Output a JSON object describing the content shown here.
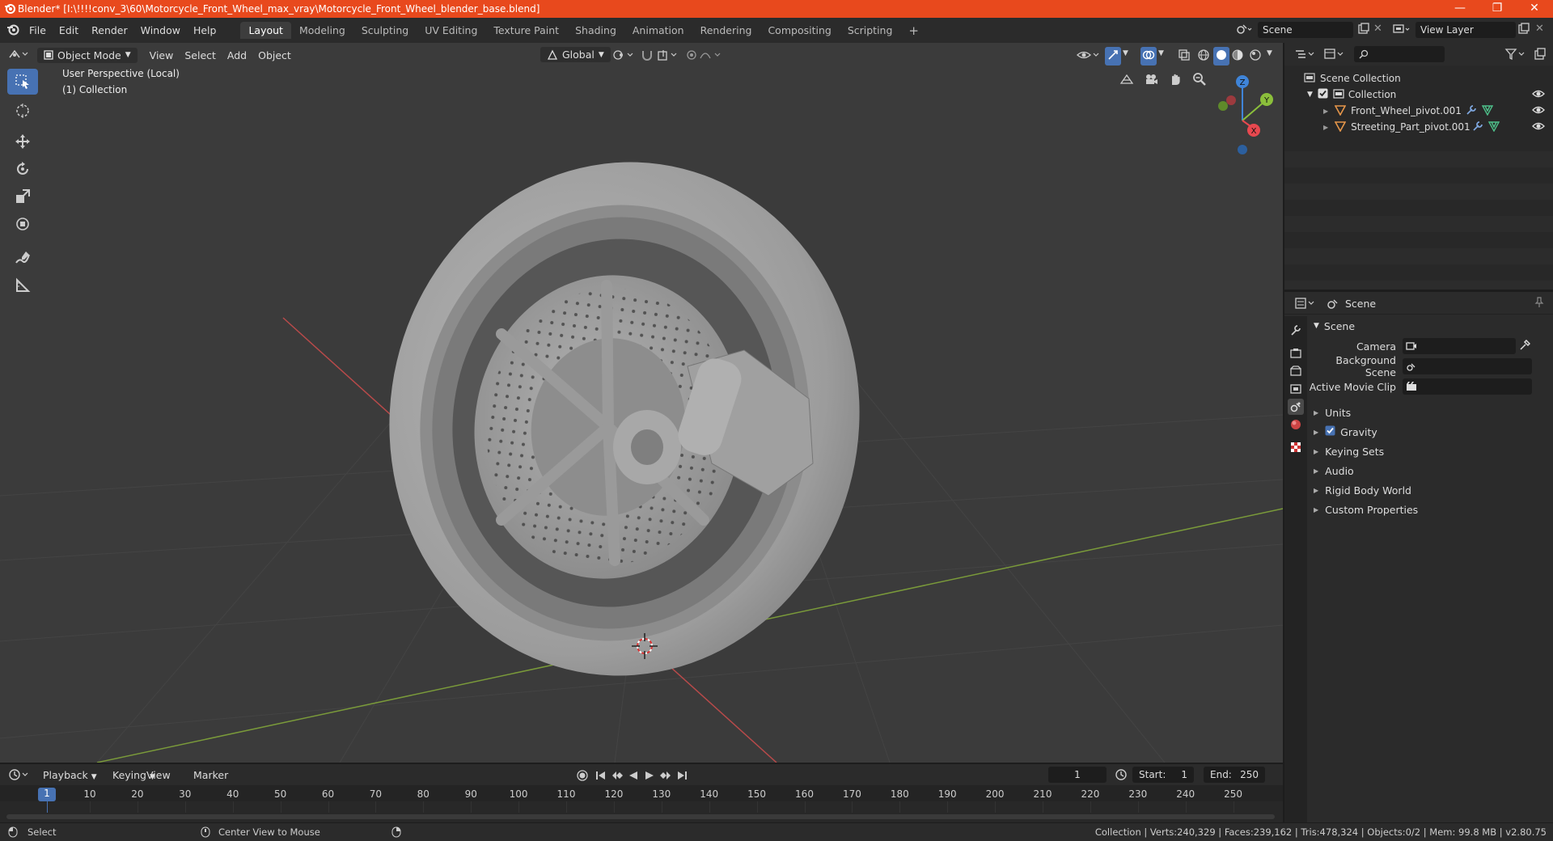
{
  "titlebar": {
    "title": "Blender* [I:\\!!!!conv_3\\60\\Motorcycle_Front_Wheel_max_vray\\Motorcycle_Front_Wheel_blender_base.blend]",
    "minimize": "—",
    "restore": "❐",
    "close": "✕"
  },
  "menubar": {
    "menus": [
      "File",
      "Edit",
      "Render",
      "Window",
      "Help"
    ],
    "workspaces": [
      "Layout",
      "Modeling",
      "Sculpting",
      "UV Editing",
      "Texture Paint",
      "Shading",
      "Animation",
      "Rendering",
      "Compositing",
      "Scripting"
    ],
    "active_workspace": "Layout",
    "add_workspace": "+",
    "scene_name": "Scene",
    "view_layer": "View Layer"
  },
  "viewport": {
    "mode": "Object Mode",
    "menus": [
      "View",
      "Select",
      "Add",
      "Object"
    ],
    "orientation": "Global",
    "perspective_label": "User Perspective (Local)",
    "collection_label": "(1) Collection",
    "gizmo_axes": {
      "x": "X",
      "y": "Y",
      "z": "Z"
    }
  },
  "outliner": {
    "search_placeholder": "",
    "scene_collection": "Scene Collection",
    "collection": "Collection",
    "objects": [
      "Front_Wheel_pivot.001",
      "Streeting_Part_pivot.001"
    ]
  },
  "properties": {
    "context": "Scene",
    "panel_title": "Scene",
    "fields": [
      {
        "label": "Camera",
        "value": ""
      },
      {
        "label": "Background Scene",
        "value": ""
      },
      {
        "label": "Active Movie Clip",
        "value": ""
      }
    ],
    "subpanels": [
      "Units",
      "Gravity",
      "Keying Sets",
      "Audio",
      "Rigid Body World",
      "Custom Properties"
    ],
    "gravity_checked": true
  },
  "timeline": {
    "menus": [
      "Playback",
      "Keying",
      "View",
      "Marker"
    ],
    "current_frame": "1",
    "start_label": "Start:",
    "start": "1",
    "end_label": "End:",
    "end": "250",
    "ticks": [
      "1",
      "10",
      "20",
      "30",
      "40",
      "50",
      "60",
      "70",
      "80",
      "90",
      "100",
      "110",
      "120",
      "130",
      "140",
      "150",
      "160",
      "170",
      "180",
      "190",
      "200",
      "210",
      "220",
      "230",
      "240",
      "250"
    ]
  },
  "statusbar": {
    "select": "Select",
    "center_view": "Center View to Mouse",
    "stats": "Collection | Verts:240,329 | Faces:239,162 | Tris:478,324 | Objects:0/2 | Mem: 99.8 MB | v2.80.75"
  },
  "colors": {
    "titlebar": "#e8491d",
    "accent": "#4772b3",
    "x_axis": "#e8484f",
    "y_axis": "#8bbf3b",
    "z_axis": "#3f84d8",
    "object_icon": "#e6964a"
  }
}
